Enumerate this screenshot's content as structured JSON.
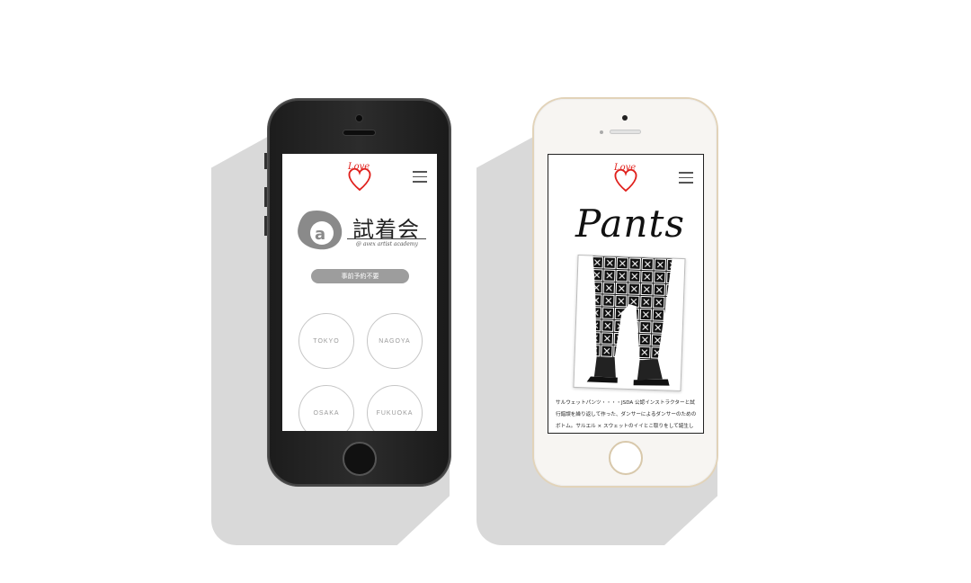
{
  "left_phone": {
    "logo_text": "Love",
    "heading": "試着会",
    "subtitle": "@ avex artist academy",
    "reservation_pill": "事前予約不要",
    "cities": [
      "TOKYO",
      "NAGOYA",
      "OSAKA",
      "FUKUOKA"
    ]
  },
  "right_phone": {
    "logo_text": "Love",
    "heading": "Pants",
    "body_text": "サルウェットパンツ・・・・JSDA 公認インストラクターと試行錯誤を繰り返して作った、ダンサーによるダンサーのためのボトム。サルエル × スウェットのイイとこ取りをして誕生した【サル"
  },
  "colors": {
    "accent_red": "#e0201c",
    "shadow": "#d9d9d9",
    "pill": "#9d9d9d",
    "gold_frame": "#e2d3b9"
  }
}
